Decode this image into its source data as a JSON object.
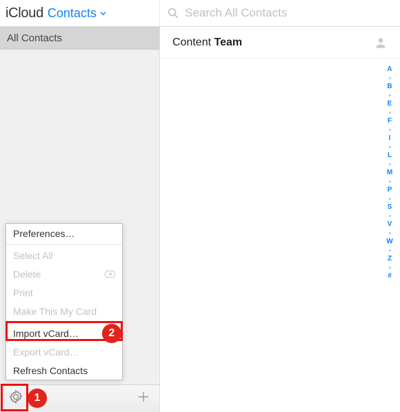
{
  "header": {
    "brand": "iCloud",
    "section_label": "Contacts",
    "search_placeholder": "Search All Contacts"
  },
  "sidebar": {
    "group_label": "All Contacts"
  },
  "contact": {
    "first_name": "Content",
    "last_name": "Team"
  },
  "alpha_index": [
    "A",
    "B",
    "E",
    "F",
    "I",
    "L",
    "M",
    "P",
    "S",
    "V",
    "W",
    "Z",
    "#"
  ],
  "menu": {
    "preferences": "Preferences…",
    "select_all": "Select All",
    "delete": "Delete",
    "print": "Print",
    "make_my_card": "Make This My Card",
    "import_vcard": "Import vCard…",
    "export_vcard": "Export vCard…",
    "refresh": "Refresh Contacts"
  },
  "annotations": {
    "badge1": "1",
    "badge2": "2"
  },
  "colors": {
    "accent": "#0a84ff",
    "annotation": "#e2231a"
  }
}
